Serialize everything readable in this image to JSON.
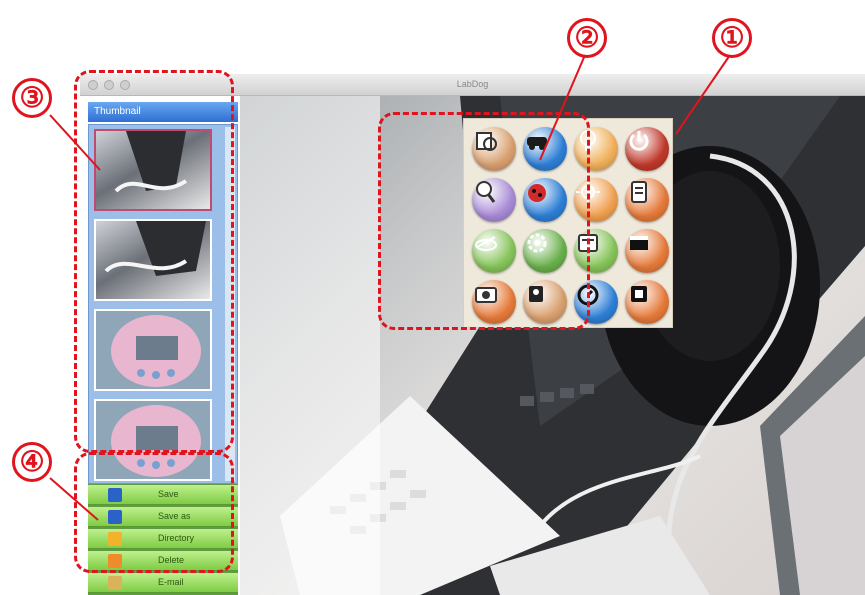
{
  "window": {
    "title": "LabDog",
    "titlebar_buttons": [
      "close-icon",
      "minimize-icon",
      "zoom-icon"
    ]
  },
  "left_panel": {
    "thumbnail_header": "Thumbnail",
    "thumbnails": [
      {
        "subject": "keyboard",
        "selected": true
      },
      {
        "subject": "keyboard",
        "selected": false
      },
      {
        "subject": "clock",
        "selected": false
      },
      {
        "subject": "clock",
        "selected": false
      }
    ],
    "actions": [
      {
        "label": "Save",
        "icon": "floppy-disk-icon",
        "color": "#2b62c8"
      },
      {
        "label": "Save as",
        "icon": "floppy-disk-icon",
        "color": "#2b62c8"
      },
      {
        "label": "Directory",
        "icon": "folder-icon",
        "color": "#f2b22b"
      },
      {
        "label": "Delete",
        "icon": "trash-icon",
        "color": "#f08b2b"
      },
      {
        "label": "E-mail",
        "icon": "email-icon",
        "color": "#d9b25a"
      }
    ]
  },
  "function_menu": {
    "buttons": [
      {
        "icon": "capture-settings-icon",
        "color": "#d9a070"
      },
      {
        "icon": "car-icon",
        "color": "#2e7fd6"
      },
      {
        "icon": "lamp-icon",
        "color": "#f0b05a"
      },
      {
        "icon": "power-icon",
        "color": "#c0392b"
      },
      {
        "icon": "zoom-icon",
        "color": "#a98bd6"
      },
      {
        "icon": "ladybug-icon",
        "color": "#2e7fd6"
      },
      {
        "icon": "brightness-icon",
        "color": "#f0a050"
      },
      {
        "icon": "document-icon",
        "color": "#e57a3a"
      },
      {
        "icon": "freeze-icon",
        "color": "#86c45a"
      },
      {
        "icon": "settings-icon",
        "color": "#6ab04c"
      },
      {
        "icon": "notes-icon",
        "color": "#86c45a"
      },
      {
        "icon": "record-window-icon",
        "color": "#e57a3a"
      },
      {
        "icon": "camera-icon",
        "color": "#e57a3a"
      },
      {
        "icon": "video-camera-icon",
        "color": "#d9a070"
      },
      {
        "icon": "timer-icon",
        "color": "#2e7fd6"
      },
      {
        "icon": "stop-icon",
        "color": "#e57a3a"
      }
    ]
  },
  "callouts": [
    {
      "number": "①"
    },
    {
      "number": "②"
    },
    {
      "number": "③"
    },
    {
      "number": "④"
    }
  ],
  "colors": {
    "callout_red": "#e0141d",
    "thumbnail_header_blue": "#2d6fd3",
    "action_green": "#7fcc45"
  }
}
